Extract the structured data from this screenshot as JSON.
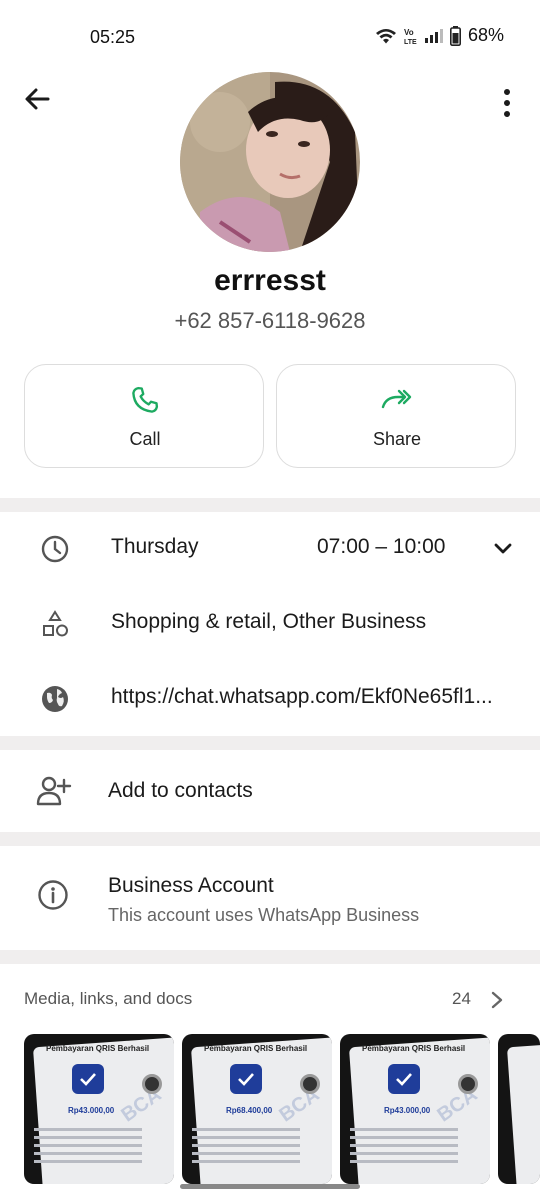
{
  "status_bar": {
    "time": "05:25",
    "battery": "68%",
    "icons": [
      "wifi-icon",
      "volte-icon",
      "signal-icon",
      "battery-icon"
    ]
  },
  "header": {
    "back_icon": "arrow-left-icon",
    "menu_icon": "more-vertical-icon",
    "name": "errresst",
    "phone": "+62 857-6118-9628"
  },
  "actions": [
    {
      "label": "Call",
      "icon": "phone-icon",
      "color": "#1daa61"
    },
    {
      "label": "Share",
      "icon": "forward-icon",
      "color": "#1daa61"
    }
  ],
  "info": {
    "day": "Thursday",
    "hours": "07:00 – 10:00",
    "category": "Shopping & retail, Other Business",
    "link": "https://chat.whatsapp.com/Ekf0Ne65fl1..."
  },
  "add_contact": {
    "label": "Add to contacts"
  },
  "business": {
    "title": "Business Account",
    "subtitle": "This account uses WhatsApp Business"
  },
  "media": {
    "title": "Media, links, and docs",
    "count": "24",
    "thumbnails": [
      {
        "title": "Pembayaran QRIS Berhasil",
        "amount": "Rp43.000,00"
      },
      {
        "title": "Pembayaran QRIS Berhasil",
        "amount": "Rp68.400,00"
      },
      {
        "title": "Pembayaran QRIS Berhasil",
        "amount": "Rp43.000,00"
      }
    ],
    "watermark": "BCA"
  },
  "colors": {
    "accent_green": "#1daa61",
    "link_blue": "#1a6ebd",
    "divider": "#f0eeee"
  }
}
